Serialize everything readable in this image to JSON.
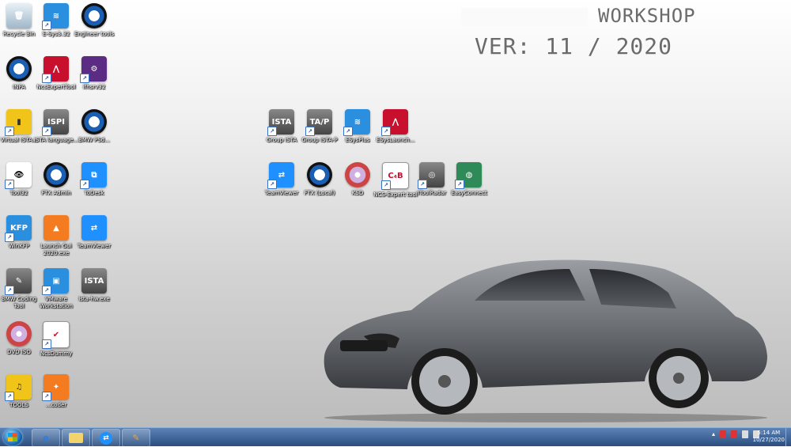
{
  "header": {
    "title_suffix": "WORKSHOP",
    "version": "VER: 11 / 2020"
  },
  "desktop_icons": [
    {
      "id": "recycle",
      "label": "Recycle Bin",
      "icon": "recycle-bin-icon"
    },
    {
      "id": "esys",
      "label": "E-Sys3.32",
      "icon": "esys-icon"
    },
    {
      "id": "engineer",
      "label": "Engineer tools",
      "icon": "bmw-logo-icon"
    },
    {
      "id": "inpa",
      "label": "INPA",
      "icon": "bmw-logo-icon"
    },
    {
      "id": "ncsexpert",
      "label": "NcsExpertTool",
      "icon": "ncs-icon"
    },
    {
      "id": "ifh",
      "label": "ifhsrv32",
      "icon": "shortcut-icon"
    },
    {
      "id": "virtualista",
      "label": "Virtual ISTA...",
      "icon": "folder-icon"
    },
    {
      "id": "istalang",
      "label": "ISTA language...",
      "icon": "ispi-icon"
    },
    {
      "id": "bmwpsd",
      "label": "BMW PSd...",
      "icon": "bmw-logo-icon"
    },
    {
      "id": "tool32",
      "label": "Tool32",
      "icon": "eye-icon"
    },
    {
      "id": "ftxadmin",
      "label": "FTX Admin",
      "icon": "bmw-logo-icon"
    },
    {
      "id": "todesk",
      "label": "ToDesk",
      "icon": "todesk-icon"
    },
    {
      "id": "winkfp",
      "label": "WinKFP",
      "icon": "kfp-icon"
    },
    {
      "id": "launch",
      "label": "Launch Gui 2020.exe",
      "icon": "flame-icon"
    },
    {
      "id": "teamviewer1",
      "label": "TeamViewer",
      "icon": "teamviewer-icon"
    },
    {
      "id": "codingtool",
      "label": "BMW Coding Tool",
      "icon": "tools-icon"
    },
    {
      "id": "vmware",
      "label": "VMware Workstation",
      "icon": "vmware-icon"
    },
    {
      "id": "istahw",
      "label": "ista-hw.exe",
      "icon": "ista-icon"
    },
    {
      "id": "dvd",
      "label": "DVD ISO",
      "icon": "cd-icon"
    },
    {
      "id": "ncsdummy",
      "label": "NcsDummy",
      "icon": "checkmark-icon"
    },
    {
      "id": "tools",
      "label": "TOOLS",
      "icon": "folder-icon"
    },
    {
      "id": "coder",
      "label": "...coder",
      "icon": "coder-icon"
    },
    {
      "id": "groupista",
      "label": "Group ISTA",
      "icon": "ista-icon"
    },
    {
      "id": "groupistap",
      "label": "Group ISTA-P",
      "icon": "istap-icon"
    },
    {
      "id": "esysplus",
      "label": "ESysPlus",
      "icon": "esys-icon"
    },
    {
      "id": "esyslauncher",
      "label": "ESysLaunch...",
      "icon": "ncs-icon"
    },
    {
      "id": "teamviewer2",
      "label": "TeamViewer",
      "icon": "teamviewer-icon"
    },
    {
      "id": "ftxlocal",
      "label": "FTX (Local)",
      "icon": "bmw-logo-icon"
    },
    {
      "id": "ksd",
      "label": "KSD",
      "icon": "ksd-icon"
    },
    {
      "id": "ncsexpert2",
      "label": "NCS-Expert tool",
      "icon": "ncs-expert-icon"
    },
    {
      "id": "toolradar",
      "label": "IToolRadar",
      "icon": "radar-icon"
    },
    {
      "id": "easyconnect",
      "label": "EasyConnect",
      "icon": "globe-icon"
    }
  ],
  "taskbar": {
    "pinned": [
      {
        "label": "e",
        "icon": "internet-explorer-icon"
      },
      {
        "label": "",
        "icon": "folder-icon"
      },
      {
        "label": "",
        "icon": "teamviewer-icon"
      },
      {
        "label": "",
        "icon": "paint-icon"
      }
    ],
    "clock_time": "5:14 AM",
    "clock_date": "10/27/2020"
  },
  "colors": {
    "header_text": "#6b6b6b",
    "taskbar_top": "#5b83b7",
    "taskbar_bottom": "#2b4e80"
  }
}
